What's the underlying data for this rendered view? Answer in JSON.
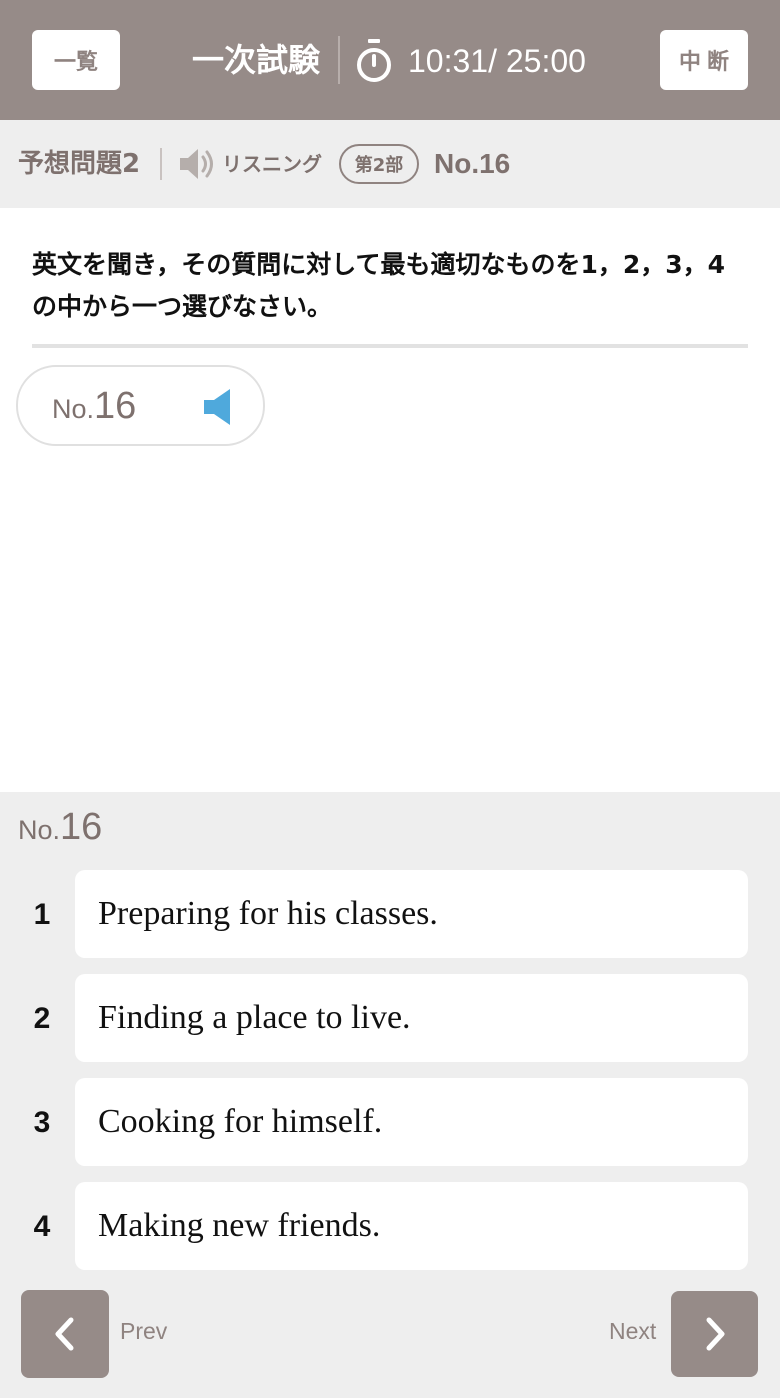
{
  "header": {
    "list_button": "一覧",
    "exam_title": "一次試験",
    "timer": "10:31/ 25:00",
    "pause_button": "中断"
  },
  "subheader": {
    "set_name": "予想問題2",
    "section": "リスニング",
    "part": "第2部",
    "question_number": "No.16"
  },
  "instruction": "英文を聞き，その質問に対して最も適切なものを1，2，3，4の中から一つ選びなさい。",
  "audio": {
    "prefix": "No.",
    "number": "16"
  },
  "answers": {
    "prefix": "No.",
    "number": "16",
    "choices": [
      {
        "num": "1",
        "text": "Preparing for his classes."
      },
      {
        "num": "2",
        "text": "Finding a place to live."
      },
      {
        "num": "3",
        "text": "Cooking for himself."
      },
      {
        "num": "4",
        "text": "Making new friends."
      }
    ]
  },
  "nav": {
    "prev_label": "Prev",
    "next_label": "Next"
  },
  "colors": {
    "header_bg": "#968b88",
    "accent_text": "#7e716e",
    "panel_bg": "#eeeeee",
    "speaker_blue": "#4fa9dc"
  }
}
